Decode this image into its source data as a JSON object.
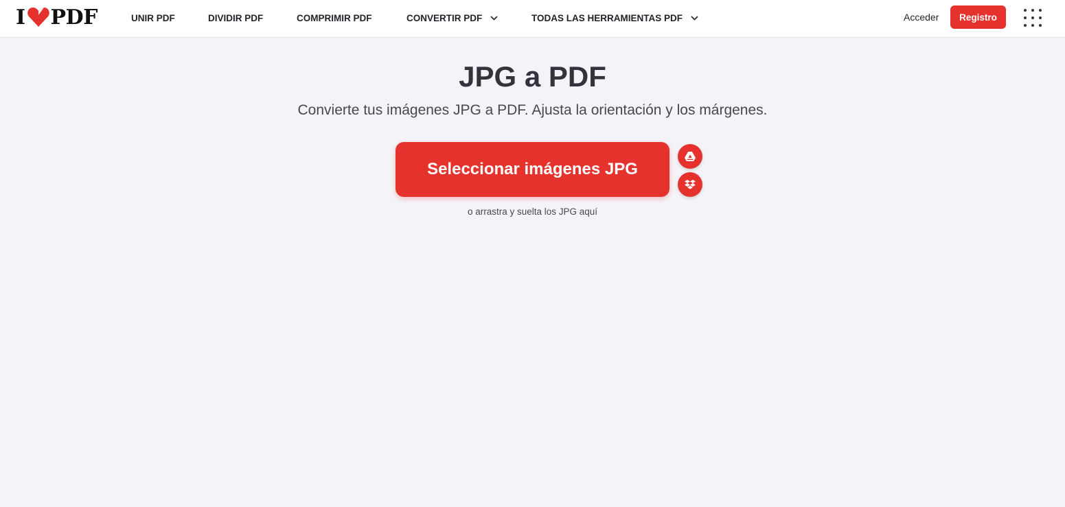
{
  "header": {
    "logo": {
      "left": "I",
      "right": "PDF",
      "heart_icon": "heart-icon"
    },
    "nav": [
      {
        "label": "UNIR PDF"
      },
      {
        "label": "DIVIDIR PDF"
      },
      {
        "label": "COMPRIMIR PDF"
      },
      {
        "label": "CONVERTIR PDF",
        "icon": "chevron-down-icon"
      },
      {
        "label": "TODAS LAS HERRAMIENTAS PDF",
        "icon": "chevron-down-icon"
      }
    ],
    "login_label": "Acceder",
    "signup_label": "Registro",
    "apps_icon": "apps-grid-icon"
  },
  "main": {
    "title": "JPG a PDF",
    "subtitle": "Convierte tus imágenes JPG a PDF. Ajusta la orientación y los márgenes.",
    "select_button_label": "Seleccionar imágenes JPG",
    "cloud_buttons": [
      {
        "icon": "google-drive-icon"
      },
      {
        "icon": "dropbox-icon"
      }
    ],
    "drop_hint": "o arrastra y suelta los JPG aquí"
  },
  "colors": {
    "accent": "#e5322d",
    "background": "#f4f4f8",
    "header_bg": "#ffffff",
    "text": "#33333b"
  }
}
